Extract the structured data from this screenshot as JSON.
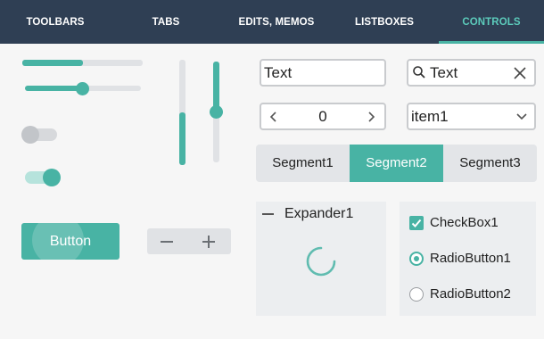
{
  "nav": {
    "tabs": [
      {
        "label": "TOOLBARS",
        "active": false
      },
      {
        "label": "TABS",
        "active": false
      },
      {
        "label": "EDITS, MEMOS",
        "active": false
      },
      {
        "label": "LISTBOXES",
        "active": false
      },
      {
        "label": "CONTROLS",
        "active": true
      }
    ]
  },
  "controls": {
    "progress_fraction": 0.5,
    "horizontal_slider_fraction": 0.5,
    "vertical_progress_fraction": 0.5,
    "vertical_slider_fraction": 0.5,
    "switch_top_on": false,
    "switch_bottom_on": true,
    "button_label": "Button",
    "stepper_minus_icon": "minus-icon",
    "stepper_plus_icon": "plus-icon"
  },
  "fields": {
    "text_value": "Text",
    "search_value": "Text",
    "search_icon": "search-icon",
    "clear_icon": "close-icon",
    "spin_value": "0",
    "combo_value": "item1"
  },
  "segments": {
    "items": [
      "Segment1",
      "Segment2",
      "Segment3"
    ],
    "selected": "Segment2"
  },
  "expander": {
    "label": "Expander1",
    "icon": "collapse-icon"
  },
  "choices": {
    "checkbox_label": "CheckBox1",
    "checkbox_checked": true,
    "radio1_label": "RadioButton1",
    "radio1_selected": true,
    "radio2_label": "RadioButton2",
    "radio2_selected": false
  },
  "colors": {
    "accent": "#48b3a4",
    "nav_background": "#2f3f54",
    "nav_active_text": "#5ccbbb"
  }
}
